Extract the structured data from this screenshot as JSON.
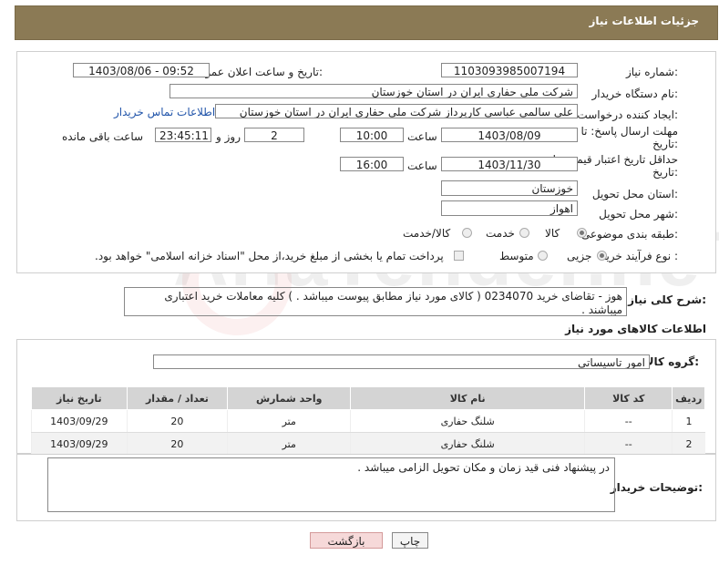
{
  "header": {
    "title": "جزئیات اطلاعات نیاز"
  },
  "form": {
    "need_number_label": "شماره نیاز:",
    "need_number": "1103093985007194",
    "announce_label": "تاریخ و ساعت اعلان عمومی:",
    "announce_value": "1403/08/06 - 09:52",
    "buyer_org_label": "نام دستگاه خریدار:",
    "buyer_org": "شرکت ملی حفاری ایران در استان خوزستان",
    "creator_label": "ایجاد کننده درخواست:",
    "creator": "علي سالمي عباسي كارپرداز شركت ملي حفاري ايران در استان خوزستان",
    "contact_link": "اطلاعات تماس خریدار",
    "deadline_label_1": "مهلت ارسال پاسخ: تا",
    "deadline_label_2": "تاریخ:",
    "deadline_date": "1403/08/09",
    "time_label": "ساعت",
    "deadline_time": "10:00",
    "days_value": "2",
    "days_label": "روز و",
    "remaining_time": "23:45:11",
    "remaining_label": "ساعت باقی مانده",
    "validity_label_1": "حداقل تاریخ اعتبار قیمت: تا",
    "validity_label_2": "تاریخ:",
    "validity_date": "1403/11/30",
    "validity_time": "16:00",
    "province_label": "استان محل تحویل:",
    "province": "خوزستان",
    "city_label": "شهر محل تحویل:",
    "city": "اهواز",
    "category_label": "طبقه بندی موضوعی:",
    "category_options": [
      "کالا",
      "خدمت",
      "کالا/خدمت"
    ],
    "purchase_type_label": "نوع فرآیند خرید :",
    "purchase_options": [
      "جزیی",
      "متوسط"
    ],
    "payment_note": "پرداخت تمام یا بخشی از مبلغ خرید،از محل \"اسناد خزانه اسلامی\" خواهد بود."
  },
  "description": {
    "label": "شرح کلی نیاز:",
    "text": "هوز - تقاضای خرید 0234070 ( کالای مورد نیاز مطابق پیوست میباشد . ) کلیه معاملات خرید اعتباری میباشند ."
  },
  "goods": {
    "section_title": "اطلاعات کالاهای مورد نیاز",
    "group_label": "گروه کالا:",
    "group_value": "امور تاسیساتی",
    "columns": [
      "ردیف",
      "کد کالا",
      "نام کالا",
      "واحد شمارش",
      "تعداد / مقدار",
      "تاریخ نیاز"
    ],
    "rows": [
      [
        "1",
        "--",
        "شلنگ حفاری",
        "متر",
        "20",
        "1403/09/29"
      ],
      [
        "2",
        "--",
        "شلنگ حفاری",
        "متر",
        "20",
        "1403/09/29"
      ]
    ]
  },
  "buyer_notes": {
    "label": "توضیحات خریدار:",
    "text": "در پیشنهاد فنی قید زمان و مکان تحویل الزامی میباشد ."
  },
  "buttons": {
    "print": "چاپ",
    "back": "بازگشت"
  },
  "watermark": "AriaTender.neT",
  "colors": {
    "header_bg": "#8b7a55",
    "back_btn_bg": "#f6d9d9",
    "table_header_bg": "#d4d4d4"
  }
}
